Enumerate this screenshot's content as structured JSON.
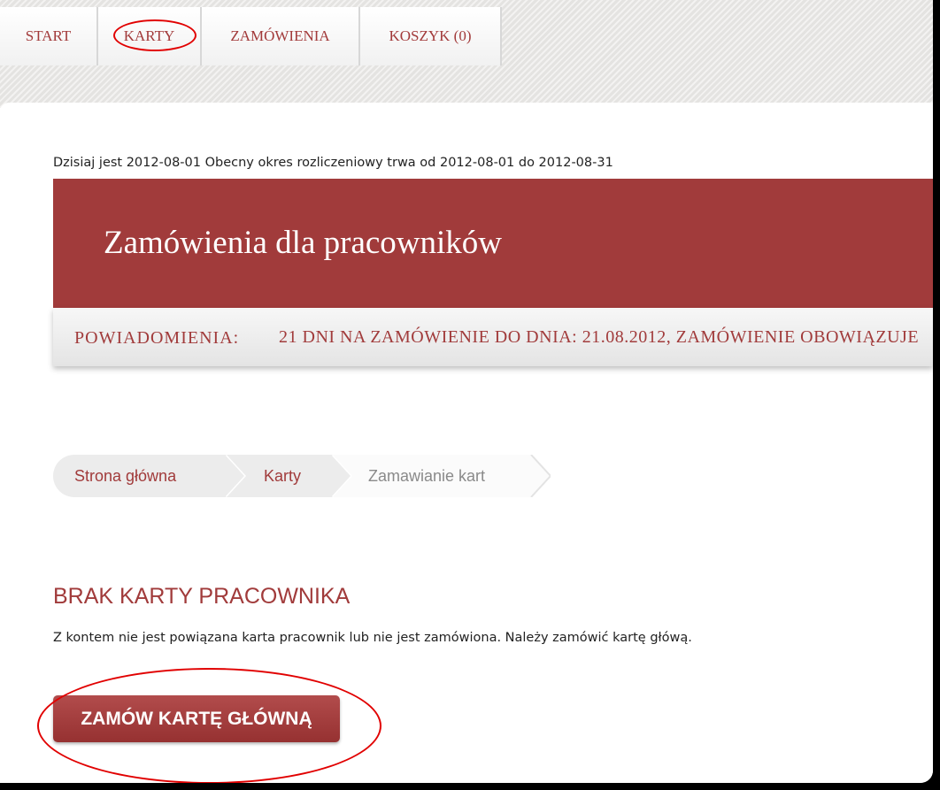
{
  "nav": {
    "tabs": [
      {
        "label": "START"
      },
      {
        "label": "KARTY"
      },
      {
        "label": "ZAMÓWIENIA"
      },
      {
        "label": "KOSZYK (0)"
      }
    ]
  },
  "info": {
    "date_line": "Dzisiaj jest 2012-08-01 Obecny okres rozliczeniowy trwa od 2012-08-01 do 2012-08-31"
  },
  "banner": {
    "title": "Zamówienia dla pracowników"
  },
  "notifications": {
    "label": "POWIADOMIENIA:",
    "text": "21 DNI NA ZAMÓWIENIE DO DNIA: 21.08.2012, ZAMÓWIENIE OBOWIĄZUJE"
  },
  "breadcrumb": {
    "items": [
      {
        "label": "Strona główna"
      },
      {
        "label": "Karty"
      },
      {
        "label": "Zamawianie kart"
      }
    ]
  },
  "section": {
    "title": "BRAK KARTY PRACOWNIKA",
    "text": "Z kontem nie jest powiązana karta pracownik lub nie jest zamówiona. Należy zamówić kartę główą.",
    "button_label": "ZAMÓW KARTĘ GŁÓWNĄ"
  },
  "colors": {
    "accent": "#a13b3b",
    "highlight_annotation": "#e10000"
  }
}
